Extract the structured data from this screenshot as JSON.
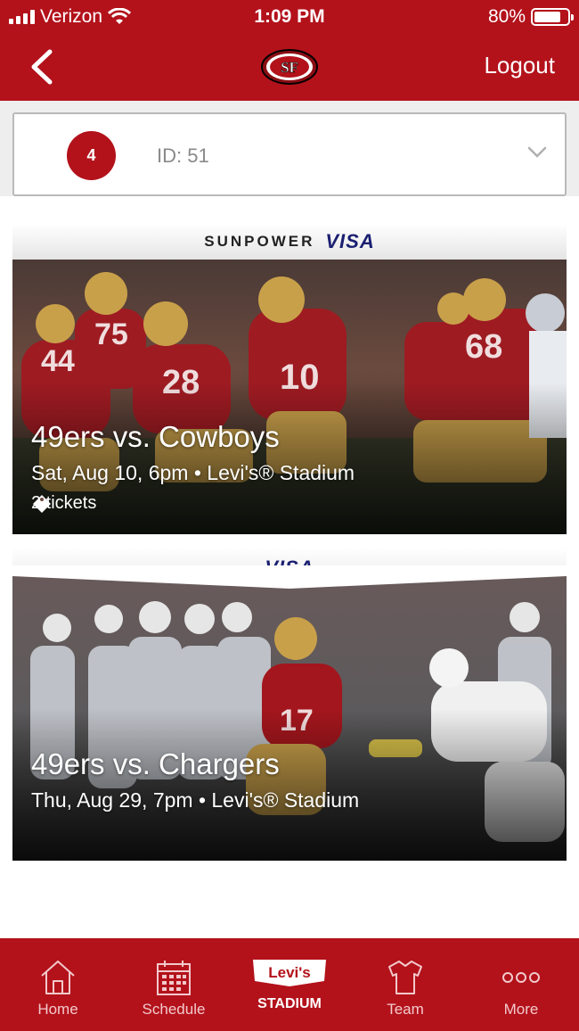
{
  "status_bar": {
    "carrier": "Verizon",
    "time": "1:09 PM",
    "battery": "80%",
    "battery_level": 0.8
  },
  "nav": {
    "logout_label": "Logout",
    "back_icon": "chevron-left-icon",
    "logo_text": "SF"
  },
  "account": {
    "badge": "4",
    "id_text": "ID: 51"
  },
  "events": [
    {
      "sponsor_primary": "SUNPOWER",
      "sponsor_secondary": "VISA",
      "title": "49ers vs. Cowboys",
      "details": "Sat, Aug 10, 6pm • Levi's® Stadium",
      "tickets": "2 tickets"
    },
    {
      "sponsor_secondary": "VISA",
      "title": "49ers vs. Chargers",
      "details": "Thu, Aug 29, 7pm • Levi's® Stadium"
    }
  ],
  "tabs": [
    {
      "label": "Home",
      "icon": "home-icon"
    },
    {
      "label": "Schedule",
      "icon": "calendar-icon"
    },
    {
      "label_line1": "Levi's",
      "label_line2": "STADIUM",
      "icon": "levis-stadium-logo"
    },
    {
      "label": "Team",
      "icon": "jersey-icon"
    },
    {
      "label": "More",
      "icon": "more-dots-icon"
    }
  ],
  "colors": {
    "brand_red": "#b3121b",
    "gold": "#c9a04a",
    "visa_blue": "#1a1f71"
  }
}
